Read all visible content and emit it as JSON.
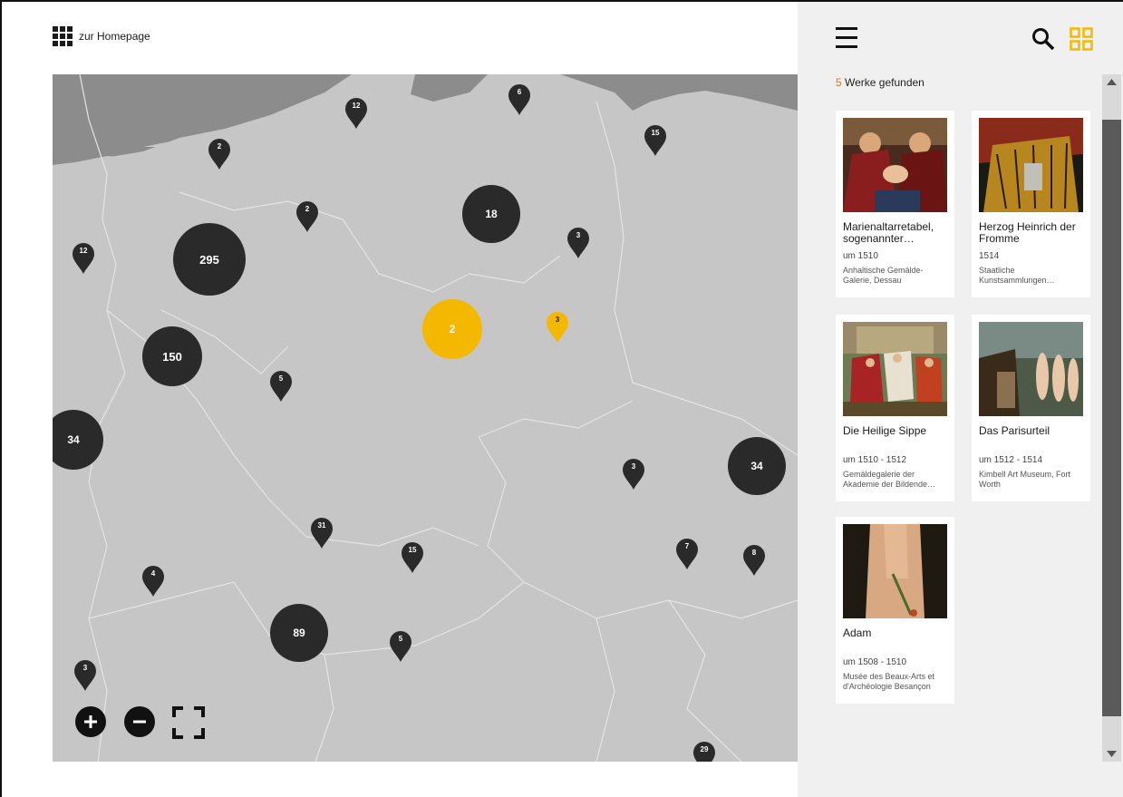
{
  "header": {
    "home_label": "zur Homepage"
  },
  "map": {
    "clusters": [
      {
        "count": "295",
        "active": false
      },
      {
        "count": "150",
        "active": false
      },
      {
        "count": "18",
        "active": false
      },
      {
        "count": "2",
        "active": true
      },
      {
        "count": "34",
        "active": false
      },
      {
        "count": "34",
        "active": false
      },
      {
        "count": "89",
        "active": false
      }
    ],
    "pins": [
      {
        "count": "12",
        "active": false
      },
      {
        "count": "6",
        "active": false
      },
      {
        "count": "15",
        "active": false
      },
      {
        "count": "2",
        "active": false
      },
      {
        "count": "2",
        "active": false
      },
      {
        "count": "12",
        "active": false
      },
      {
        "count": "3",
        "active": false
      },
      {
        "count": "3",
        "active": true
      },
      {
        "count": "5",
        "active": false
      },
      {
        "count": "3",
        "active": false
      },
      {
        "count": "31",
        "active": false
      },
      {
        "count": "15",
        "active": false
      },
      {
        "count": "7",
        "active": false
      },
      {
        "count": "8",
        "active": false
      },
      {
        "count": "4",
        "active": false
      },
      {
        "count": "5",
        "active": false
      },
      {
        "count": "3",
        "active": false
      },
      {
        "count": "29",
        "active": false
      }
    ],
    "controls": {
      "zoom_in": "+",
      "zoom_out": "−"
    },
    "colors": {
      "land": "#c6c6c6",
      "water": "#8c8c8c",
      "marker": "#2a2a2a",
      "active": "#f5b800"
    }
  },
  "panel": {
    "result_count": "5",
    "result_label": " Werke gefunden",
    "works": [
      {
        "title": "Marienaltarretabel, sogenannter…",
        "date": "um 1510",
        "location": "Anhaltische Gemälde-Galerie, Dessau"
      },
      {
        "title": "Herzog Heinrich der Fromme",
        "date": "1514",
        "location": "Staatliche Kunstsammlungen…"
      },
      {
        "title": "Die Heilige Sippe",
        "date": "um 1510 - 1512",
        "location": "Gemäldegalerie der Akademie der Bildende…"
      },
      {
        "title": "Das Parisurteil",
        "date": "um 1512 - 1514",
        "location": "Kimbell Art Museum, Fort Worth"
      },
      {
        "title": "Adam",
        "date": "um 1508 - 1510",
        "location": "Musée des Beaux-Arts et d'Archéologie Besançon"
      }
    ],
    "accent_color": "#f5b800",
    "count_color": "#e07a10"
  }
}
